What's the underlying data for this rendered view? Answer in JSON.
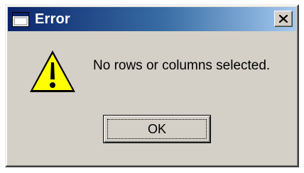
{
  "window": {
    "title": "Error",
    "title_icon": "window-icon",
    "close_icon": "close-icon"
  },
  "body": {
    "icon": "warning-icon",
    "message": "No rows or columns selected."
  },
  "buttons": {
    "ok_label": "OK"
  },
  "colors": {
    "titlebar_start": "#0a246a",
    "titlebar_end": "#a6caf0",
    "face": "#d4d0c8",
    "warning_fill": "#ffff00"
  }
}
